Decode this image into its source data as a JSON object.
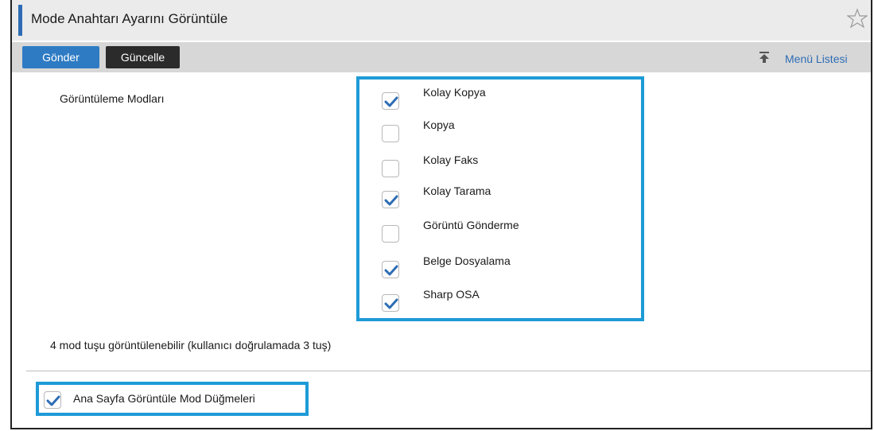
{
  "header": {
    "title": "Mode Anahtarı Ayarını Görüntüle"
  },
  "toolbar": {
    "submit_label": "Gönder",
    "update_label": "Güncelle",
    "menu_list_label": "Menü Listesi"
  },
  "modes": {
    "label": "Görüntüleme Modları",
    "items": [
      {
        "label": "Kolay Kopya",
        "checked": true
      },
      {
        "label": "Kopya",
        "checked": false
      },
      {
        "label": "Kolay Faks",
        "checked": false
      },
      {
        "label": "Kolay Tarama",
        "checked": true
      },
      {
        "label": "Görüntü Gönderme",
        "checked": false
      },
      {
        "label": "Belge Dosyalama",
        "checked": true
      },
      {
        "label": "Sharp OSA",
        "checked": true
      }
    ]
  },
  "info": {
    "text": "4 mod tuşu görüntülenebilir (kullanıcı doğrulamada 3 tuş)"
  },
  "home_buttons": {
    "label": "Ana Sayfa Görüntüle Mod Düğmeleri",
    "checked": true
  },
  "colors": {
    "accent": "#2e7bc4",
    "highlight": "#1e9bd7",
    "check": "#2e6db4"
  }
}
